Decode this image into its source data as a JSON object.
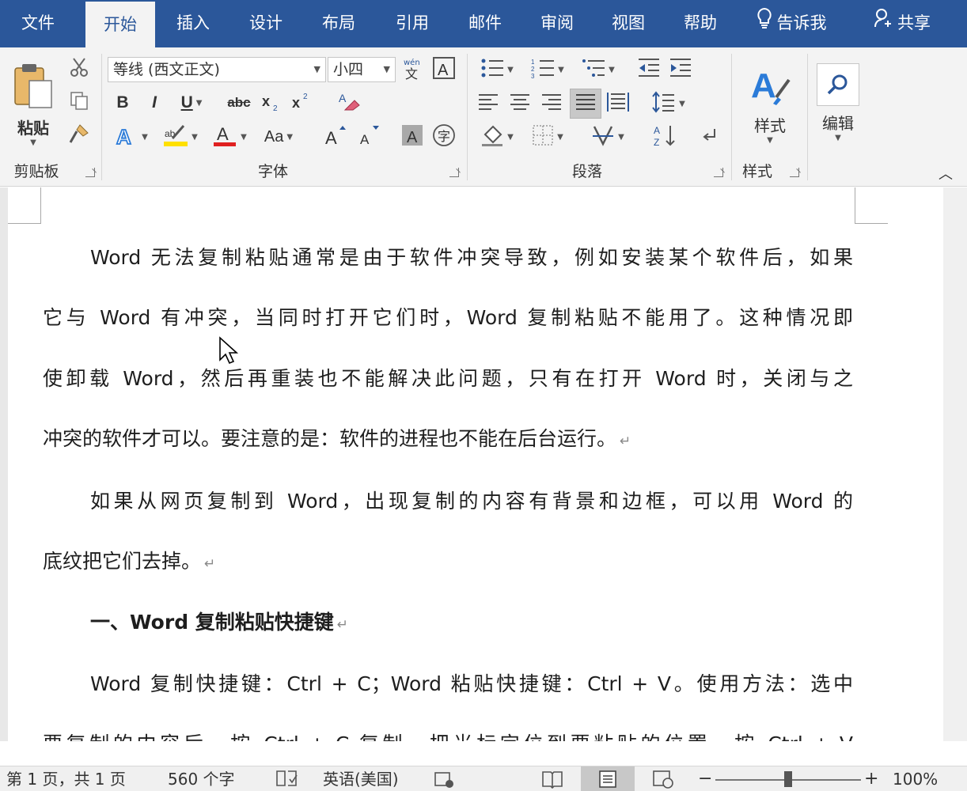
{
  "tabs": [
    {
      "label": "文件"
    },
    {
      "label": "开始"
    },
    {
      "label": "插入"
    },
    {
      "label": "设计"
    },
    {
      "label": "布局"
    },
    {
      "label": "引用"
    },
    {
      "label": "邮件"
    },
    {
      "label": "审阅"
    },
    {
      "label": "视图"
    },
    {
      "label": "帮助"
    },
    {
      "label": "告诉我"
    },
    {
      "label": "共享"
    }
  ],
  "ribbon": {
    "clipboard": {
      "paste_label": "粘贴",
      "group_label": "剪贴板"
    },
    "font": {
      "font_name": "等线 (西文正文)",
      "font_size": "小四",
      "group_label": "字体",
      "change_case": "Aa"
    },
    "paragraph": {
      "group_label": "段落"
    },
    "styles": {
      "styles_label": "样式",
      "group_label": "样式"
    },
    "editing": {
      "editing_label": "编辑"
    }
  },
  "document": {
    "paragraphs": [
      {
        "lines": [
          "Word 无法复制粘贴通常是由于软件冲突导致，例如安装某个软件后，如果",
          "它与 Word 有冲突，当同时打开它们时，Word 复制粘贴不能用了。这种情况即",
          "使卸载 Word，然后再重装也不能解决此问题，只有在打开 Word 时，关闭与之",
          "冲突的软件才可以。要注意的是：软件的进程也不能在后台运行。"
        ]
      },
      {
        "lines": [
          "如果从网页复制到 Word，出现复制的内容有背景和边框，可以用 Word 的",
          "底纹把它们去掉。"
        ]
      },
      {
        "lines": [
          "一、Word 复制粘贴快捷键"
        ]
      },
      {
        "lines": [
          "Word 复制快捷键：Ctrl + C；Word 粘贴快捷键：Ctrl + V。使用方法：选中",
          "要复制的内容后，按 Ctrl + C 复制，把光标定位到要粘贴的位置，按 Ctrl + V"
        ]
      }
    ]
  },
  "statusbar": {
    "page": "第 1 页，共 1 页",
    "words": "560 个字",
    "language": "英语(美国)",
    "zoom": "100%",
    "zoom_level": 100
  },
  "colors": {
    "accent": "#2b579a",
    "ribbon_bg": "#f3f3f3",
    "font_color_bar": "#e02020",
    "highlight_bar": "#ffe000"
  }
}
